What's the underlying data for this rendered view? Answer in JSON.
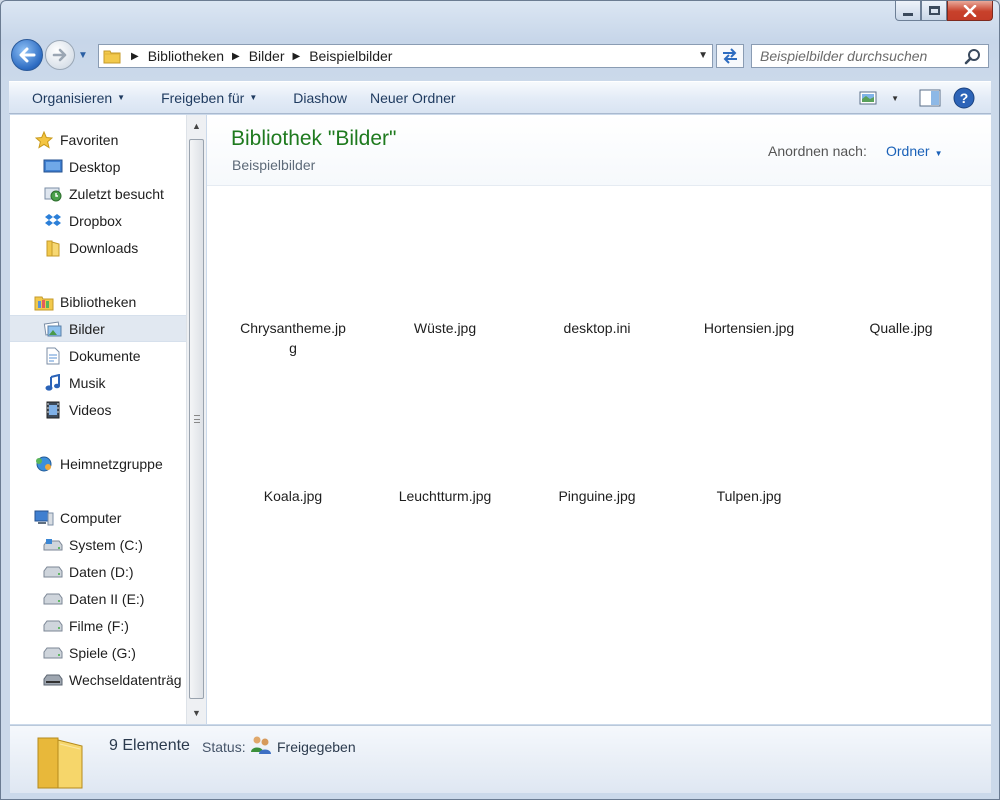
{
  "address": {
    "crumbs": [
      "Bibliotheken",
      "Bilder",
      "Beispielbilder"
    ]
  },
  "search": {
    "placeholder": "Beispielbilder durchsuchen"
  },
  "toolbar": {
    "organize": "Organisieren",
    "share": "Freigeben für",
    "slideshow": "Diashow",
    "new_folder": "Neuer Ordner"
  },
  "navigation": {
    "favorites": {
      "label": "Favoriten",
      "items": [
        "Desktop",
        "Zuletzt besucht",
        "Dropbox",
        "Downloads"
      ]
    },
    "libraries": {
      "label": "Bibliotheken",
      "items": [
        "Bilder",
        "Dokumente",
        "Musik",
        "Videos"
      ],
      "selected": "Bilder"
    },
    "homegroup": {
      "label": "Heimnetzgruppe"
    },
    "computer": {
      "label": "Computer",
      "items": [
        "System (C:)",
        "Daten (D:)",
        "Daten II (E:)",
        "Filme (F:)",
        "Spiele (G:)",
        "Wechseldatenträg"
      ]
    }
  },
  "library": {
    "title": "Bibliothek \"Bilder\"",
    "subtitle": "Beispielbilder",
    "arrange_label": "Anordnen nach:",
    "arrange_value": "Ordner"
  },
  "files": [
    {
      "line1": "Chrysantheme.jp",
      "line2": "g"
    },
    {
      "line1": "Wüste.jpg",
      "line2": ""
    },
    {
      "line1": "desktop.ini",
      "line2": ""
    },
    {
      "line1": "Hortensien.jpg",
      "line2": ""
    },
    {
      "line1": "Qualle.jpg",
      "line2": ""
    },
    {
      "line1": "Koala.jpg",
      "line2": ""
    },
    {
      "line1": "Leuchtturm.jpg",
      "line2": ""
    },
    {
      "line1": "Pinguine.jpg",
      "line2": ""
    },
    {
      "line1": "Tulpen.jpg",
      "line2": ""
    }
  ],
  "status": {
    "count": "9 Elemente",
    "label": "Status:",
    "value": "Freigegeben"
  },
  "colors": {
    "title_green": "#1e7a1e",
    "link_blue": "#1a61b8",
    "selection": "#e1e8f1"
  }
}
